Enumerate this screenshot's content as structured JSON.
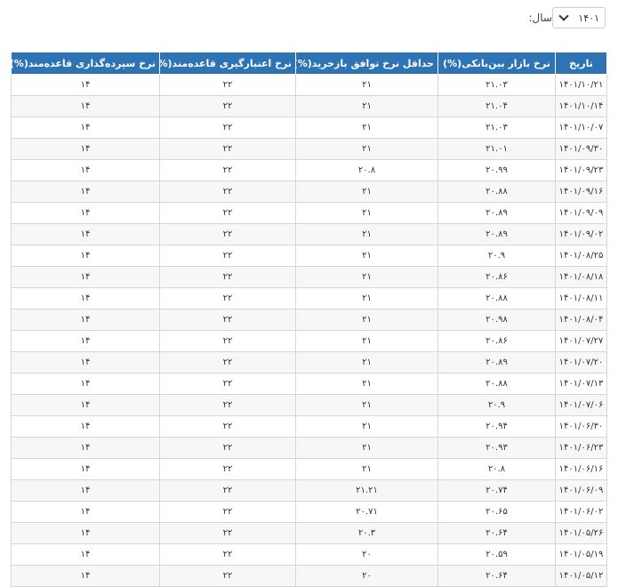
{
  "filter": {
    "label": "سال:",
    "selected_year": "۱۴۰۱"
  },
  "table": {
    "headers": [
      "تاریخ",
      "نرخ بازار بین‌بانکی(%)",
      "حداقل نرخ توافق بازخرید(%)",
      "نرخ اعتبارگیری قاعده‌مند(%)",
      "نرخ سپرده‌گذاری قاعده‌مند(%)"
    ],
    "rows": [
      [
        "۱۴۰۱/۱۰/۲۱",
        "۲۱.۰۳",
        "۲۱",
        "۲۲",
        "۱۴"
      ],
      [
        "۱۴۰۱/۱۰/۱۴",
        "۲۱.۰۴",
        "۲۱",
        "۲۲",
        "۱۴"
      ],
      [
        "۱۴۰۱/۱۰/۰۷",
        "۲۱.۰۳",
        "۲۱",
        "۲۲",
        "۱۴"
      ],
      [
        "۱۴۰۱/۰۹/۳۰",
        "۲۱.۰۱",
        "۲۱",
        "۲۲",
        "۱۴"
      ],
      [
        "۱۴۰۱/۰۹/۲۳",
        "۲۰.۹۹",
        "۲۰.۸",
        "۲۲",
        "۱۴"
      ],
      [
        "۱۴۰۱/۰۹/۱۶",
        "۲۰.۸۸",
        "۲۱",
        "۲۲",
        "۱۴"
      ],
      [
        "۱۴۰۱/۰۹/۰۹",
        "۲۰.۸۹",
        "۲۱",
        "۲۲",
        "۱۴"
      ],
      [
        "۱۴۰۱/۰۹/۰۲",
        "۲۰.۸۹",
        "۲۱",
        "۲۲",
        "۱۴"
      ],
      [
        "۱۴۰۱/۰۸/۲۵",
        "۲۰.۹",
        "۲۱",
        "۲۲",
        "۱۴"
      ],
      [
        "۱۴۰۱/۰۸/۱۸",
        "۲۰.۸۶",
        "۲۱",
        "۲۲",
        "۱۴"
      ],
      [
        "۱۴۰۱/۰۸/۱۱",
        "۲۰.۸۸",
        "۲۱",
        "۲۲",
        "۱۴"
      ],
      [
        "۱۴۰۱/۰۸/۰۴",
        "۲۰.۹۸",
        "۲۱",
        "۲۲",
        "۱۴"
      ],
      [
        "۱۴۰۱/۰۷/۲۷",
        "۲۰.۸۶",
        "۲۱",
        "۲۲",
        "۱۴"
      ],
      [
        "۱۴۰۱/۰۷/۲۰",
        "۲۰.۸۹",
        "۲۱",
        "۲۲",
        "۱۴"
      ],
      [
        "۱۴۰۱/۰۷/۱۳",
        "۲۰.۸۸",
        "۲۱",
        "۲۲",
        "۱۴"
      ],
      [
        "۱۴۰۱/۰۷/۰۶",
        "۲۰.۹",
        "۲۱",
        "۲۲",
        "۱۴"
      ],
      [
        "۱۴۰۱/۰۶/۳۰",
        "۲۰.۹۴",
        "۲۱",
        "۲۲",
        "۱۴"
      ],
      [
        "۱۴۰۱/۰۶/۲۳",
        "۲۰.۹۳",
        "۲۱",
        "۲۲",
        "۱۴"
      ],
      [
        "۱۴۰۱/۰۶/۱۶",
        "۲۰.۸",
        "۲۱",
        "۲۲",
        "۱۴"
      ],
      [
        "۱۴۰۱/۰۶/۰۹",
        "۲۰.۷۴",
        "۲۱.۲۱",
        "۲۲",
        "۱۴"
      ],
      [
        "۱۴۰۱/۰۶/۰۲",
        "۲۰.۶۵",
        "۲۰.۷۱",
        "۲۲",
        "۱۴"
      ],
      [
        "۱۴۰۱/۰۵/۲۶",
        "۲۰.۶۴",
        "۲۰.۳",
        "۲۲",
        "۱۴"
      ],
      [
        "۱۴۰۱/۰۵/۱۹",
        "۲۰.۵۹",
        "۲۰",
        "۲۲",
        "۱۴"
      ],
      [
        "۱۴۰۱/۰۵/۱۲",
        "۲۰.۶۴",
        "۲۰",
        "۲۲",
        "۱۴"
      ]
    ]
  }
}
